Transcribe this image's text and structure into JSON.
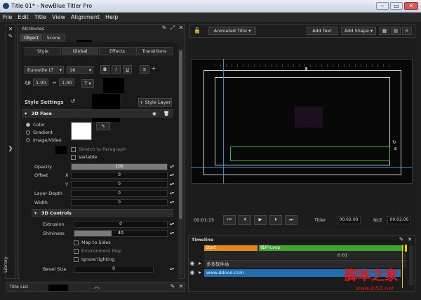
{
  "window": {
    "title": "Title 01* - NewBlue Titler Pro",
    "min": "–",
    "max": "▭",
    "close": "✕"
  },
  "menu": [
    "File",
    "Edit",
    "Title",
    "View",
    "Alignment",
    "Help"
  ],
  "attributes": {
    "panel_title": "Attributes",
    "tabs": [
      "Object",
      "Scene"
    ],
    "subtabs": [
      "Style",
      "Global",
      "Effects",
      "Transitions"
    ],
    "font": "Eurostile LT",
    "font_size": "16",
    "bold": "B",
    "italic": "I",
    "underline": "U",
    "line_spacing": "1.00",
    "char_spacing": "1.00",
    "style_settings": "Style Settings",
    "add_style_layer": "+ Style Layer",
    "face_section": "3D Face",
    "fill_types": [
      "Color",
      "Gradient",
      "Image/Video"
    ],
    "stretch_label": "Stretch to Paragraph",
    "variable_label": "Variable",
    "opacity_label": "Opacity",
    "opacity_value": "100",
    "opacity_fraction": 1.0,
    "offset_label": "Offset",
    "x_label": "X",
    "x_value": "0",
    "y_label": "Y",
    "y_value": "0",
    "layer_depth_label": "Layer Depth",
    "layer_depth_value": "0",
    "width_label": "Width",
    "width_value": "0",
    "controls_section": "3D Controls",
    "extrusion_label": "Extrusion",
    "extrusion_value": "0",
    "shininess_label": "Shininess",
    "shininess_value": "40",
    "shininess_fraction": 0.4,
    "map_to_sides": "Map to Sides",
    "environment_map": "Environment Map",
    "ignore_lighting": "Ignore lighting",
    "bevel_size_label": "Bevel Size",
    "bevel_size_value": "0"
  },
  "library_label": "Library",
  "title_list_label": "Title List",
  "toolbar": {
    "animated_title": "Animated Title",
    "add_text": "Add Text",
    "add_shape": "Add Shape"
  },
  "transport": {
    "current_time": "00:01:15",
    "titler_label": "Titler",
    "titler_time": "00:02:00",
    "nle_label": "NLE",
    "nle_time": "00:02:00"
  },
  "timeline": {
    "title": "Timeline",
    "start_label": "Start",
    "loop_label": "循环/Loop",
    "tick_label": "0:01",
    "track1": "多多软件站",
    "track2": "www.ddooo.com"
  },
  "watermark": {
    "text": "脚本之家",
    "url": "www.jb51.net"
  },
  "colors": {
    "accent": "#7ab5e6",
    "timeline_orange": "#e08a1e",
    "timeline_green": "#3fa62d",
    "track_blue": "#1f6fb0",
    "watermark_red": "#e0171a"
  }
}
